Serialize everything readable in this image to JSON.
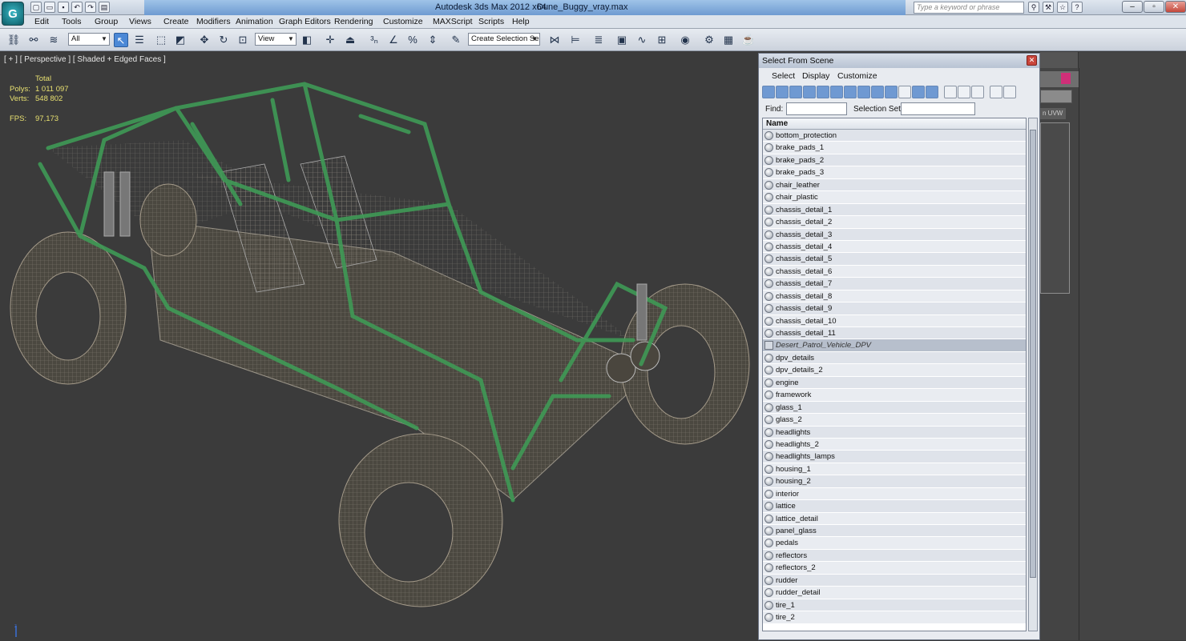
{
  "titlebar": {
    "app_title": "Autodesk 3ds Max  2012 x64",
    "file_name": "Dune_Buggy_vray.max",
    "search_placeholder": "Type a keyword or phrase"
  },
  "menu": [
    "Edit",
    "Tools",
    "Group",
    "Views",
    "Create",
    "Modifiers",
    "Animation",
    "Graph Editors",
    "Rendering",
    "Customize",
    "MAXScript",
    "Scripts",
    "Help"
  ],
  "toolbar": {
    "selection_filter": "All",
    "reference_coord": "View",
    "selection_set": "Create Selection Se"
  },
  "viewport": {
    "label": "[ + ] [ Perspective ] [ Shaded + Edged Faces ]",
    "stats_header": "Total",
    "polys_label": "Polys:",
    "polys_value": "1 011 097",
    "verts_label": "Verts:",
    "verts_value": "548 802",
    "fps_label": "FPS:",
    "fps_value": "97,173",
    "colors": {
      "wire_green": "#3f9a56",
      "wire_grey": "#9a9488",
      "background": "#3b3b3b"
    }
  },
  "dialog": {
    "title": "Select From Scene",
    "menu": [
      "Select",
      "Display",
      "Customize"
    ],
    "find_label": "Find:",
    "selection_set_label": "Selection Set:",
    "column_name": "Name",
    "selected_item": "Desert_Patrol_Vehicle_DPV",
    "items": [
      "bottom_protection",
      "brake_pads_1",
      "brake_pads_2",
      "brake_pads_3",
      "chair_leather",
      "chair_plastic",
      "chassis_detail_1",
      "chassis_detail_2",
      "chassis_detail_3",
      "chassis_detail_4",
      "chassis_detail_5",
      "chassis_detail_6",
      "chassis_detail_7",
      "chassis_detail_8",
      "chassis_detail_9",
      "chassis_detail_10",
      "chassis_detail_11",
      "Desert_Patrol_Vehicle_DPV",
      "dpv_details",
      "dpv_details_2",
      "engine",
      "framework",
      "glass_1",
      "glass_2",
      "headlights",
      "headlights_2",
      "headlights_lamps",
      "housing_1",
      "housing_2",
      "interior",
      "lattice",
      "lattice_detail",
      "panel_glass",
      "pedals",
      "reflectors",
      "reflectors_2",
      "rudder",
      "rudder_detail",
      "tire_1",
      "tire_2"
    ]
  },
  "right_panel": {
    "uvw_label": "n UVW",
    "accent": "#cf2f78"
  }
}
